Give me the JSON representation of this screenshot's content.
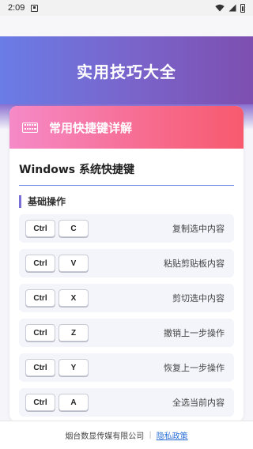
{
  "status_bar": {
    "time": "2:09"
  },
  "hero": {
    "title": "实用技巧大全"
  },
  "card": {
    "header_title": "常用快捷键详解",
    "section_title": "Windows 系统快捷键",
    "sub_heading": "基础操作",
    "rows": [
      {
        "keys": [
          "Ctrl",
          "C"
        ],
        "desc": "复制选中内容"
      },
      {
        "keys": [
          "Ctrl",
          "V"
        ],
        "desc": "粘贴剪贴板内容"
      },
      {
        "keys": [
          "Ctrl",
          "X"
        ],
        "desc": "剪切选中内容"
      },
      {
        "keys": [
          "Ctrl",
          "Z"
        ],
        "desc": "撤销上一步操作"
      },
      {
        "keys": [
          "Ctrl",
          "Y"
        ],
        "desc": "恢复上一步操作"
      },
      {
        "keys": [
          "Ctrl",
          "A"
        ],
        "desc": "全选当前内容"
      }
    ]
  },
  "footer": {
    "company": "烟台数显传媒有限公司",
    "divider": "|",
    "privacy_link": "隐私政策"
  },
  "colors": {
    "hero_start": "#6a7ce6",
    "hero_end": "#7d4fb0",
    "header_start": "#f58ac8",
    "header_end": "#f75a6e",
    "accent": "#7a6fd6",
    "link": "#2a6fd6"
  },
  "icons": [
    "keyboard-icon",
    "wifi-icon",
    "signal-icon",
    "battery-icon"
  ]
}
